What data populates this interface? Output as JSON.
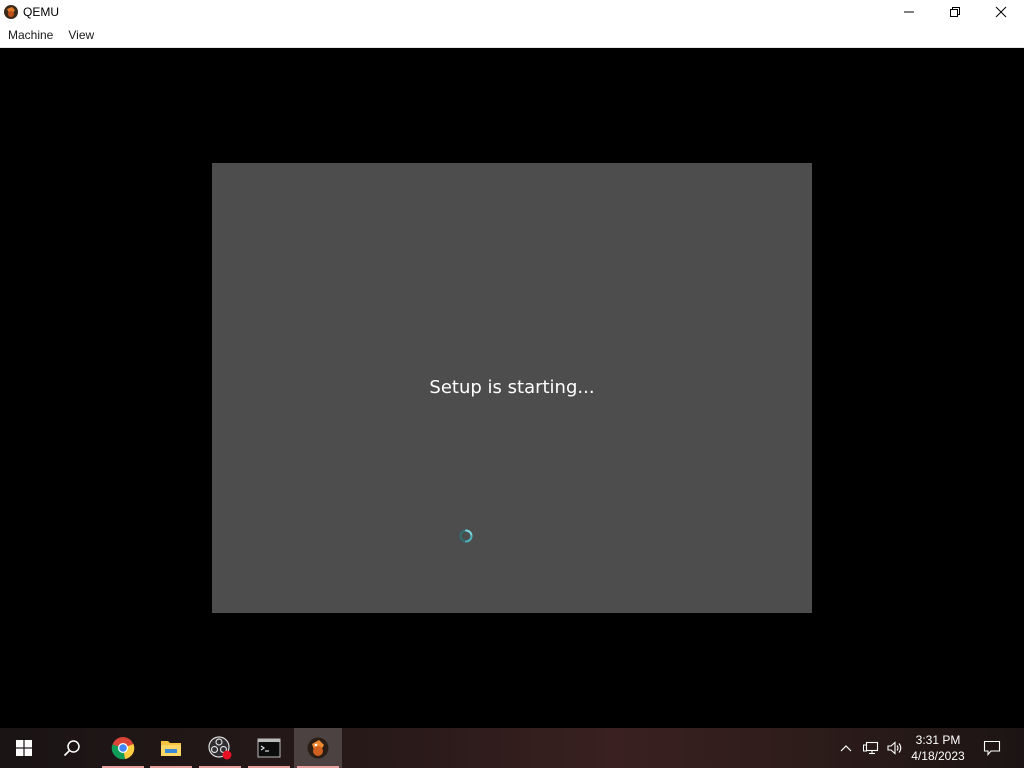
{
  "window": {
    "title": "QEMU",
    "menu": [
      {
        "label": "Machine"
      },
      {
        "label": "View"
      }
    ]
  },
  "setup": {
    "message": "Setup is starting..."
  },
  "taskbar": {
    "apps": [
      {
        "name": "start",
        "icon": "windows-logo-icon"
      },
      {
        "name": "search",
        "icon": "search-icon"
      },
      {
        "name": "chrome",
        "icon": "chrome-icon"
      },
      {
        "name": "file-explorer",
        "icon": "folder-icon"
      },
      {
        "name": "obs",
        "icon": "obs-icon"
      },
      {
        "name": "terminal",
        "icon": "terminal-icon"
      },
      {
        "name": "qemu",
        "icon": "qemu-icon",
        "active": true
      }
    ],
    "clock": {
      "time": "3:31 PM",
      "date": "4/18/2023"
    }
  },
  "colors": {
    "vm_background": "#000000",
    "setup_panel": "#4d4d4d",
    "spinner_accent": "#5bc0c8",
    "active_app_underline": "#e8a0a0"
  }
}
